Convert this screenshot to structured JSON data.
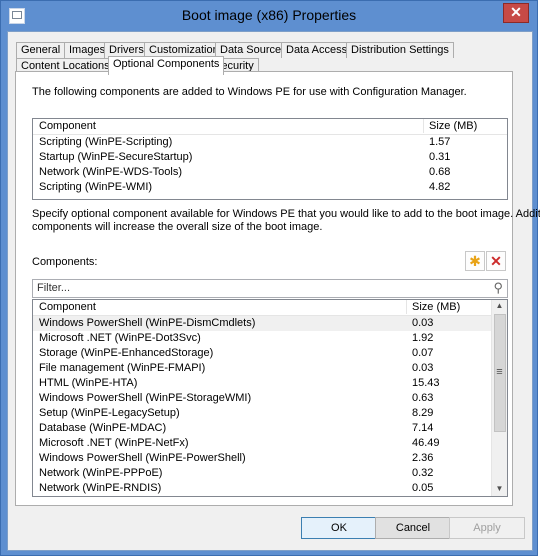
{
  "window": {
    "title": "Boot image (x86) Properties",
    "close": "✕"
  },
  "tabs_row1": [
    "General",
    "Images",
    "Drivers",
    "Customization",
    "Data Source",
    "Data Access",
    "Distribution Settings"
  ],
  "tabs_row2": [
    "Content Locations",
    "Optional Components",
    "Security"
  ],
  "active_tab": "Optional Components",
  "intro_text": "The following components are added to Windows PE for use with Configuration Manager.",
  "added": {
    "headers": {
      "component": "Component",
      "size": "Size (MB)"
    },
    "rows": [
      {
        "component": "Scripting (WinPE-Scripting)",
        "size": "1.57"
      },
      {
        "component": "Startup (WinPE-SecureStartup)",
        "size": "0.31"
      },
      {
        "component": "Network (WinPE-WDS-Tools)",
        "size": "0.68"
      },
      {
        "component": "Scripting (WinPE-WMI)",
        "size": "4.82"
      }
    ]
  },
  "optional_text": {
    "line1": "Specify optional component available for Windows PE that you would like to add to the boot image. Additional",
    "line2": "components will increase the overall size of the boot image."
  },
  "components_label": "Components:",
  "filter": {
    "placeholder": "Filter..."
  },
  "available": {
    "headers": {
      "component": "Component",
      "size": "Size (MB)"
    },
    "rows": [
      {
        "component": "Windows PowerShell (WinPE-DismCmdlets)",
        "size": "0.03"
      },
      {
        "component": "Microsoft .NET (WinPE-Dot3Svc)",
        "size": "1.92"
      },
      {
        "component": "Storage (WinPE-EnhancedStorage)",
        "size": "0.07"
      },
      {
        "component": "File management (WinPE-FMAPI)",
        "size": "0.03"
      },
      {
        "component": "HTML (WinPE-HTA)",
        "size": "15.43"
      },
      {
        "component": "Windows PowerShell (WinPE-StorageWMI)",
        "size": "0.63"
      },
      {
        "component": "Setup (WinPE-LegacySetup)",
        "size": "8.29"
      },
      {
        "component": "Database (WinPE-MDAC)",
        "size": "7.14"
      },
      {
        "component": "Microsoft .NET (WinPE-NetFx)",
        "size": "46.49"
      },
      {
        "component": "Windows PowerShell (WinPE-PowerShell)",
        "size": "2.36"
      },
      {
        "component": "Network (WinPE-PPPoE)",
        "size": "0.32"
      },
      {
        "component": "Network (WinPE-RNDIS)",
        "size": "0.05"
      }
    ]
  },
  "buttons": {
    "ok": "OK",
    "cancel": "Cancel",
    "apply": "Apply"
  }
}
